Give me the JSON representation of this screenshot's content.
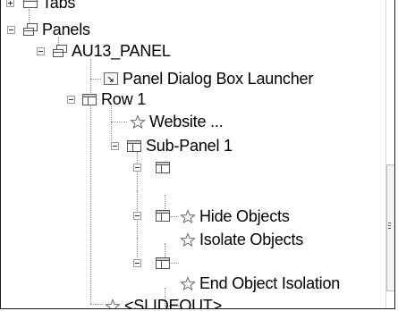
{
  "tree": {
    "tabs": {
      "label": "Tabs",
      "icon": "ribbon-tabs-icon"
    },
    "panels": {
      "label": "Panels",
      "icon": "ribbon-panels-icon"
    },
    "au13_panel": {
      "label": "AU13_PANEL",
      "icon": "ribbon-panel-icon"
    },
    "dialog_launcher": {
      "label": "Panel Dialog Box Launcher",
      "icon": "dialog-launcher-icon"
    },
    "row1": {
      "label": "Row 1",
      "icon": "panel-row-icon"
    },
    "website": {
      "label": "Website ...",
      "icon": "star-command-icon"
    },
    "subpanel1": {
      "label": "Sub-Panel 1",
      "icon": "panel-row-icon"
    },
    "hide_objects": {
      "label": "Hide Objects",
      "icon": "star-command-icon"
    },
    "isolate_objects": {
      "label": "Isolate Objects",
      "icon": "star-command-icon"
    },
    "end_isolation": {
      "label": "End Object Isolation",
      "icon": "star-command-icon"
    },
    "slideout": {
      "label": "<SLIDEOUT>",
      "icon": "star-command-icon"
    }
  }
}
